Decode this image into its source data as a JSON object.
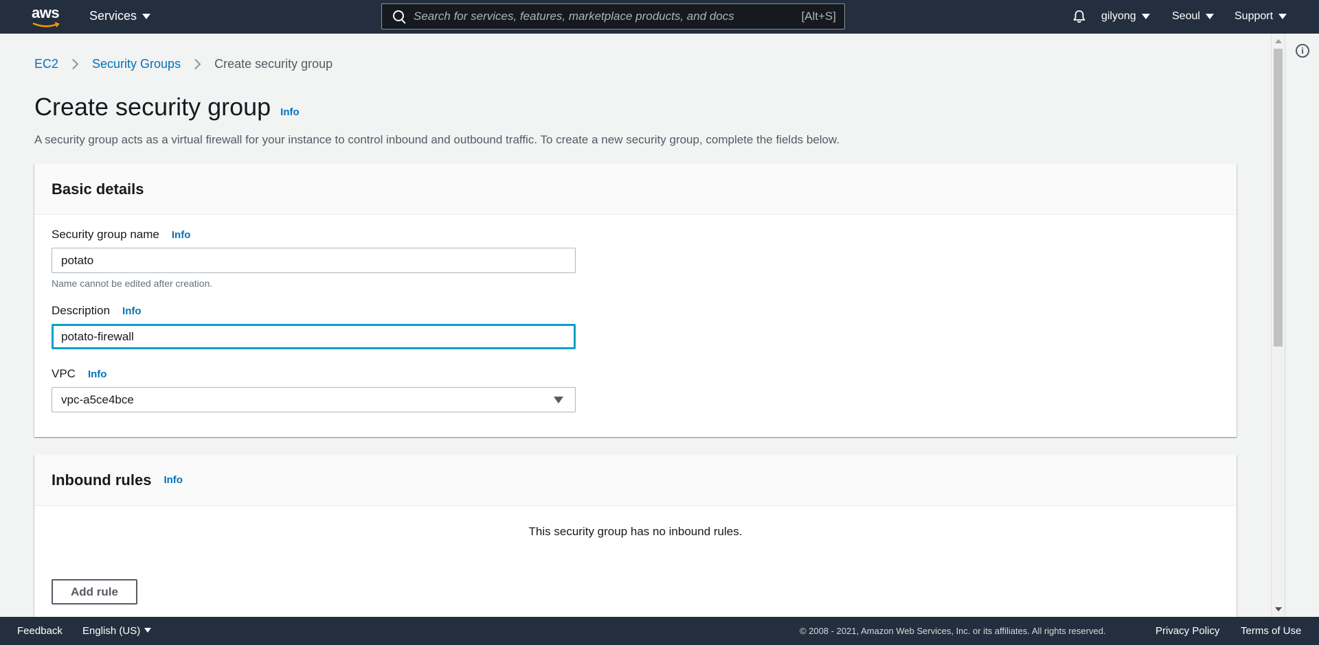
{
  "nav": {
    "logo": "aws",
    "services_label": "Services",
    "search_placeholder": "Search for services, features, marketplace products, and docs",
    "search_shortcut": "[Alt+S]",
    "bell_icon": "bell-icon",
    "user_label": "gilyong",
    "region_label": "Seoul",
    "support_label": "Support"
  },
  "breadcrumb": {
    "items": [
      "EC2",
      "Security Groups"
    ],
    "current": "Create security group"
  },
  "page": {
    "title": "Create security group",
    "info_label": "Info",
    "description": "A security group acts as a virtual firewall for your instance to control inbound and outbound traffic. To create a new security group, complete the fields below."
  },
  "basic_details": {
    "header": "Basic details",
    "name_label": "Security group name",
    "name_info": "Info",
    "name_value": "potato",
    "name_hint": "Name cannot be edited after creation.",
    "description_label": "Description",
    "description_info": "Info",
    "description_value": "potato-firewall",
    "vpc_label": "VPC",
    "vpc_info": "Info",
    "vpc_value": "vpc-a5ce4bce"
  },
  "inbound_rules": {
    "header": "Inbound rules",
    "info_label": "Info",
    "empty_message": "This security group has no inbound rules.",
    "add_rule_label": "Add rule"
  },
  "footer": {
    "feedback_label": "Feedback",
    "language_label": "English (US)",
    "copyright": "© 2008 - 2021, Amazon Web Services, Inc. or its affiliates. All rights reserved.",
    "privacy_label": "Privacy Policy",
    "terms_label": "Terms of Use"
  },
  "colors": {
    "nav_bg": "#232f3e",
    "link": "#0073bb",
    "focus": "#00a1c9",
    "page_bg": "#f2f3f3"
  }
}
